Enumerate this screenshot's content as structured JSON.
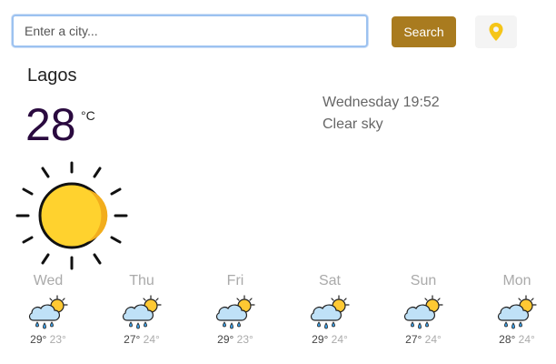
{
  "search": {
    "placeholder": "Enter a city...",
    "button_label": "Search"
  },
  "current": {
    "city": "Lagos",
    "temperature": "28",
    "unit": "°C",
    "date_time": "Wednesday 19:52",
    "condition": "Clear sky",
    "icon": "sun-icon"
  },
  "forecast": [
    {
      "day": "Wed",
      "high": "29°",
      "low": "23°",
      "icon": "rain-cloud-sun-icon"
    },
    {
      "day": "Thu",
      "high": "27°",
      "low": "24°",
      "icon": "rain-cloud-sun-icon"
    },
    {
      "day": "Fri",
      "high": "29°",
      "low": "23°",
      "icon": "rain-cloud-sun-icon"
    },
    {
      "day": "Sat",
      "high": "29°",
      "low": "24°",
      "icon": "rain-cloud-sun-icon"
    },
    {
      "day": "Sun",
      "high": "27°",
      "low": "24°",
      "icon": "rain-cloud-sun-icon"
    },
    {
      "day": "Mon",
      "high": "28°",
      "low": "24°",
      "icon": "rain-cloud-sun-icon"
    }
  ],
  "colors": {
    "search_button": "#a97b1f",
    "location_pin": "#f5c518",
    "temperature": "#2a0a3f",
    "sun_fill": "#ffd22e"
  }
}
